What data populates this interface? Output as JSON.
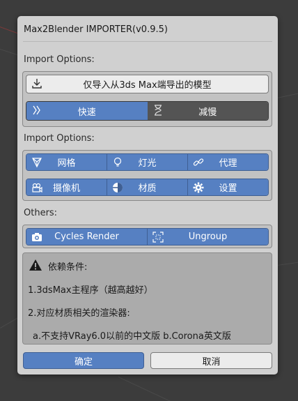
{
  "dialog": {
    "title": "Max2Blender IMPORTER(v0.9.5)"
  },
  "import_section": {
    "label": "Import Options:",
    "import_button": "仅导入从3ds Max端导出的模型",
    "speed_fast": "快速",
    "speed_slow": "减慢",
    "selected_speed": "快速"
  },
  "options_section": {
    "label": "Import Options:",
    "row1": [
      {
        "label": "网格",
        "icon": "mesh-icon"
      },
      {
        "label": "灯光",
        "icon": "light-bulb-icon"
      },
      {
        "label": "代理",
        "icon": "link-icon"
      }
    ],
    "row2": [
      {
        "label": "摄像机",
        "icon": "camera-icon"
      },
      {
        "label": "材质",
        "icon": "material-sphere-icon"
      },
      {
        "label": "设置",
        "icon": "gear-icon"
      }
    ]
  },
  "others_section": {
    "label": "Others:",
    "cycles_render": "Cycles Render",
    "ungroup": "Ungroup"
  },
  "requirements": {
    "heading": "依赖条件:",
    "line1": "1.3dsMax主程序（越高越好）",
    "line2": "2.对应材质相关的渲染器:",
    "line3": "a.不支持VRay6.0以前的中文版  b.Corona英文版"
  },
  "footer": {
    "ok": "确定",
    "cancel": "取消"
  },
  "colors": {
    "accent": "#5680c2",
    "dialog_bg": "#d0d0d0",
    "dark_toggle": "#545454"
  }
}
